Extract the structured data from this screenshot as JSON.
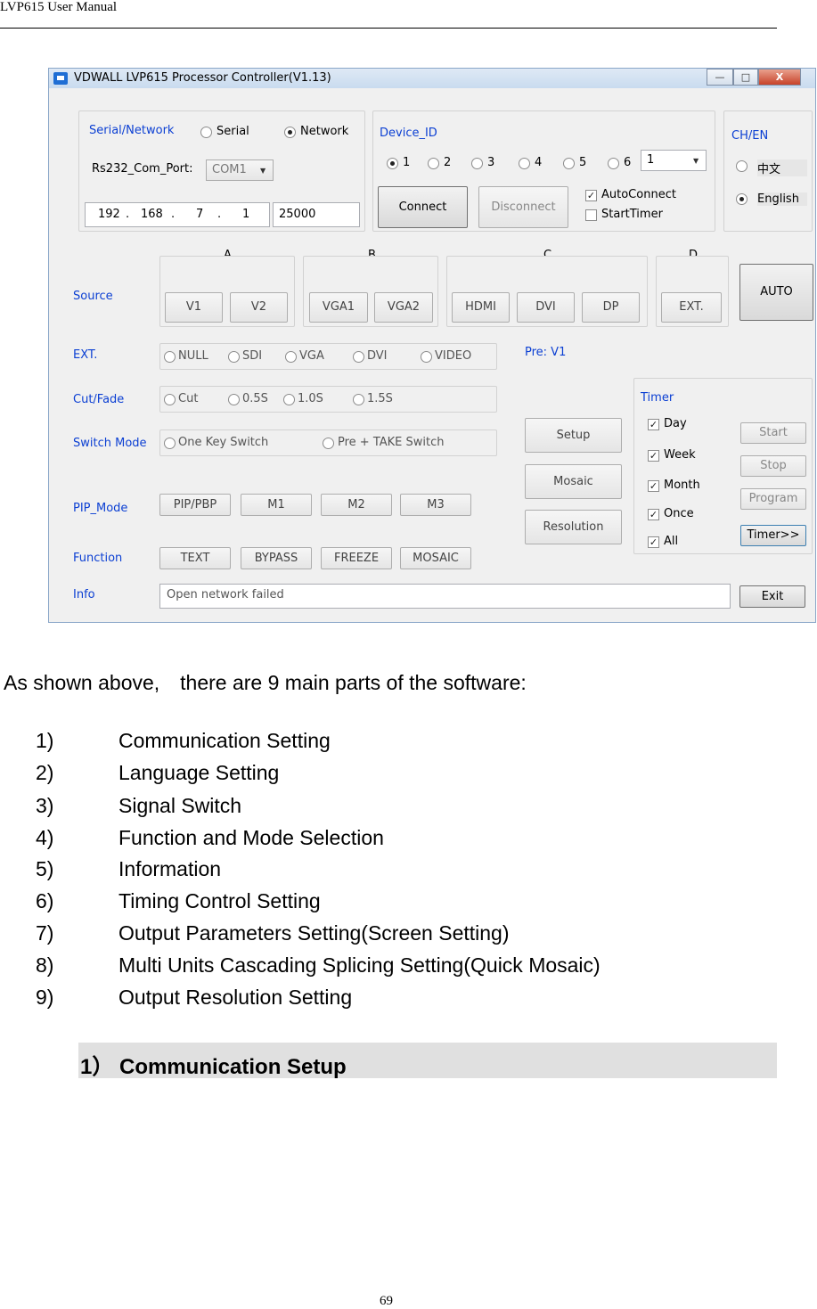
{
  "header": {
    "title": "LVP615 User Manual"
  },
  "window": {
    "title": "VDWALL LVP615 Processor Controller(V1.13)",
    "controls": {
      "minimize": "—",
      "maximize": "□",
      "close": "X"
    },
    "serial_network": {
      "label": "Serial/Network",
      "serial": "Serial",
      "network": "Network",
      "com_port_label": "Rs232_Com_Port:",
      "com_port_value": "COM1",
      "ip1": "192",
      "ip2": "168",
      "ip3": "7",
      "ip4": "1",
      "port": "25000"
    },
    "device_id": {
      "label": "Device_ID",
      "options": [
        "1",
        "2",
        "3",
        "4",
        "5",
        "6"
      ],
      "combo_value": "1",
      "connect": "Connect",
      "disconnect": "Disconnect",
      "auto_connect": "AutoConnect",
      "start_timer": "StartTimer"
    },
    "ch_en": {
      "label": "CH/EN",
      "chinese": "中文",
      "english": "English"
    },
    "source": {
      "label": "Source",
      "groups": {
        "a": {
          "title": "A",
          "buttons": [
            "V1",
            "V2"
          ]
        },
        "b": {
          "title": "B",
          "buttons": [
            "VGA1",
            "VGA2"
          ]
        },
        "c": {
          "title": "C",
          "buttons": [
            "HDMI",
            "DVI",
            "DP"
          ]
        },
        "d": {
          "title": "D",
          "buttons": [
            "EXT."
          ]
        }
      },
      "auto": "AUTO"
    },
    "ext": {
      "label": "EXT.",
      "options": [
        "NULL",
        "SDI",
        "VGA",
        "DVI",
        "VIDEO"
      ],
      "pre": "Pre: V1"
    },
    "cut_fade": {
      "label": "Cut/Fade",
      "options": [
        "Cut",
        "0.5S",
        "1.0S",
        "1.5S"
      ]
    },
    "switch_mode": {
      "label": "Switch Mode",
      "options": [
        "One Key Switch",
        "Pre + TAKE Switch"
      ]
    },
    "pip_mode": {
      "label": "PIP_Mode",
      "buttons": [
        "PIP/PBP",
        "M1",
        "M2",
        "M3"
      ]
    },
    "function": {
      "label": "Function",
      "buttons": [
        "TEXT",
        "BYPASS",
        "FREEZE",
        "MOSAIC"
      ]
    },
    "side_buttons": {
      "setup": "Setup",
      "mosaic": "Mosaic",
      "resolution": "Resolution"
    },
    "timer": {
      "label": "Timer",
      "checks": [
        "Day",
        "Week",
        "Month",
        "Once",
        "All"
      ],
      "start": "Start",
      "stop": "Stop",
      "program": "Program",
      "timer_more": "Timer>>"
    },
    "info": {
      "label": "Info",
      "message": "Open network failed",
      "exit": "Exit"
    }
  },
  "content": {
    "intro": "As shown above,　there are 9 main parts of the software:",
    "items": [
      {
        "num": "1)",
        "text": "Communication Setting"
      },
      {
        "num": "2)",
        "text": "Language Setting"
      },
      {
        "num": "3)",
        "text": "Signal Switch"
      },
      {
        "num": "4)",
        "text": "Function and Mode Selection"
      },
      {
        "num": "5)",
        "text": "Information"
      },
      {
        "num": "6)",
        "text": "Timing Control Setting"
      },
      {
        "num": "7)",
        "text": "Output Parameters Setting(Screen Setting)"
      },
      {
        "num": "8)",
        "text": "Multi Units Cascading Splicing Setting(Quick Mosaic)"
      },
      {
        "num": "9)",
        "text": "Output Resolution Setting"
      }
    ],
    "section_title": "1） Communication Setup"
  },
  "footer": {
    "page_number": "69"
  }
}
